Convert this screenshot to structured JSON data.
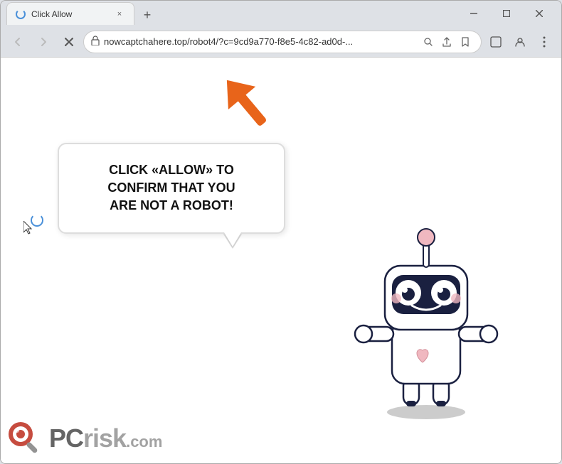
{
  "window": {
    "title": "Click Allow",
    "tab_title": "Click Allow",
    "url": "nowcaptchahere.top/robot4/?c=9cd9a770-f8e5-4c82-ad0d-...",
    "new_tab_label": "+",
    "close_label": "×",
    "minimize_label": "—",
    "restore_label": "❐",
    "close_window_label": "✕"
  },
  "toolbar": {
    "back_label": "←",
    "forward_label": "→",
    "reload_label": "✕",
    "search_icon": "🔍",
    "share_icon": "⬆",
    "bookmark_icon": "☆",
    "extensions_icon": "□",
    "profile_icon": "👤",
    "menu_icon": "⋮"
  },
  "page": {
    "bubble_text_line1": "CLICK «ALLOW» TO CONFIRM THAT YOU",
    "bubble_text_line2": "ARE NOT A ROBOT!",
    "colors": {
      "arrow_orange": "#E8641A",
      "bubble_border": "#dddddd",
      "robot_outline": "#1a2040",
      "robot_pink": "#f0b8c0",
      "robot_body": "#ffffff",
      "robot_dark": "#1a2040"
    }
  },
  "watermark": {
    "text_pc": "PC",
    "text_risk": "risk",
    "text_domain": ".com"
  }
}
